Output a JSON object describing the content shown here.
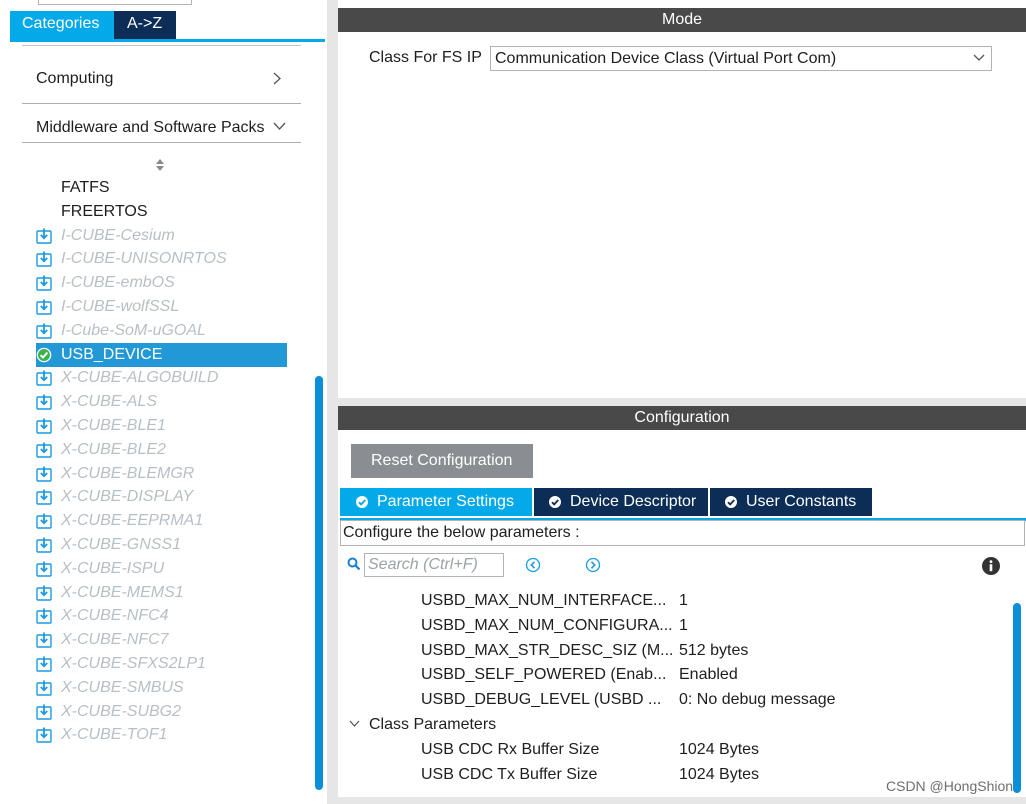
{
  "left_panel": {
    "tabs": {
      "categories": "Categories",
      "az": "A->Z"
    },
    "categories": [
      {
        "label": "Computing"
      },
      {
        "label": "Middleware and Software Packs"
      }
    ],
    "plain_items": [
      "FATFS",
      "FREERTOS"
    ],
    "packs": [
      {
        "label": "I-CUBE-Cesium",
        "state": "disabled"
      },
      {
        "label": "I-CUBE-UNISONRTOS",
        "state": "disabled"
      },
      {
        "label": "I-CUBE-embOS",
        "state": "disabled"
      },
      {
        "label": "I-CUBE-wolfSSL",
        "state": "disabled"
      },
      {
        "label": "I-Cube-SoM-uGOAL",
        "state": "disabled"
      },
      {
        "label": "USB_DEVICE",
        "state": "selected"
      },
      {
        "label": "X-CUBE-ALGOBUILD",
        "state": "disabled"
      },
      {
        "label": "X-CUBE-ALS",
        "state": "disabled"
      },
      {
        "label": "X-CUBE-BLE1",
        "state": "disabled"
      },
      {
        "label": "X-CUBE-BLE2",
        "state": "disabled"
      },
      {
        "label": "X-CUBE-BLEMGR",
        "state": "disabled"
      },
      {
        "label": "X-CUBE-DISPLAY",
        "state": "disabled"
      },
      {
        "label": "X-CUBE-EEPRMA1",
        "state": "disabled"
      },
      {
        "label": "X-CUBE-GNSS1",
        "state": "disabled"
      },
      {
        "label": "X-CUBE-ISPU",
        "state": "disabled"
      },
      {
        "label": "X-CUBE-MEMS1",
        "state": "disabled"
      },
      {
        "label": "X-CUBE-NFC4",
        "state": "disabled"
      },
      {
        "label": "X-CUBE-NFC7",
        "state": "disabled"
      },
      {
        "label": "X-CUBE-SFXS2LP1",
        "state": "disabled"
      },
      {
        "label": "X-CUBE-SMBUS",
        "state": "disabled"
      },
      {
        "label": "X-CUBE-SUBG2",
        "state": "disabled"
      },
      {
        "label": "X-CUBE-TOF1",
        "state": "disabled"
      }
    ]
  },
  "mode": {
    "header": "Mode",
    "class_label": "Class For FS IP",
    "class_value": "Communication Device Class (Virtual Port Com)"
  },
  "configuration": {
    "header": "Configuration",
    "reset_button": "Reset Configuration",
    "tabs": {
      "parameter_settings": "Parameter Settings",
      "device_descriptor": "Device Descriptor",
      "user_constants": "User Constants"
    },
    "hint": "Configure the below parameters :",
    "search_placeholder": "Search (Ctrl+F)",
    "parameters": [
      {
        "name": "USBD_MAX_NUM_INTERFACE...",
        "value": "1"
      },
      {
        "name": "USBD_MAX_NUM_CONFIGURA...",
        "value": "1"
      },
      {
        "name": "USBD_MAX_STR_DESC_SIZ (M...",
        "value": "512 bytes"
      },
      {
        "name": "USBD_SELF_POWERED (Enab...",
        "value": "Enabled"
      },
      {
        "name": "USBD_DEBUG_LEVEL (USBD ...",
        "value": "0: No debug message"
      }
    ],
    "class_group": {
      "label": "Class Parameters",
      "items": [
        {
          "name": "USB CDC Rx Buffer Size",
          "value": "1024 Bytes"
        },
        {
          "name": "USB CDC Tx Buffer Size",
          "value": "1024 Bytes"
        }
      ]
    }
  },
  "watermark": "CSDN @HongShion",
  "colors": {
    "accent": "#03a9e8",
    "dark_tab": "#0c2d56",
    "header_bar": "#494949",
    "selected_row": "#2398d6",
    "disabled_text": "#b7bfc6",
    "button_gray": "#8a8e92",
    "scrollbar": "#0a8fd8"
  }
}
